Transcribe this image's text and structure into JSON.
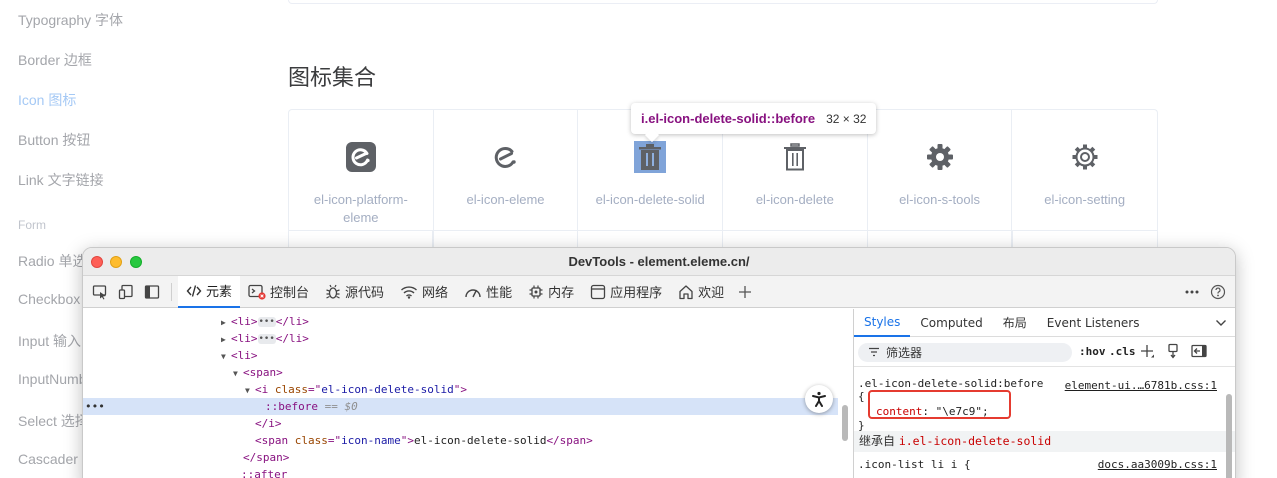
{
  "sidebar": {
    "items": [
      {
        "label": "Typography 字体",
        "active": false
      },
      {
        "label": "Border 边框",
        "active": false
      },
      {
        "label": "Icon 图标",
        "active": true
      },
      {
        "label": "Button 按钮",
        "active": false
      },
      {
        "label": "Link 文字链接",
        "active": false
      }
    ],
    "group_label": "Form",
    "form_items": [
      {
        "label": "Radio 单选"
      },
      {
        "label": "Checkbox"
      },
      {
        "label": "Input 输入"
      },
      {
        "label": "InputNumb"
      },
      {
        "label": "Select 选择"
      },
      {
        "label": "Cascader"
      }
    ]
  },
  "main": {
    "section_title": "图标集合",
    "icons": [
      {
        "name": "el-icon-platform-eleme",
        "icon": "platform-eleme-icon"
      },
      {
        "name": "el-icon-eleme",
        "icon": "eleme-icon"
      },
      {
        "name": "el-icon-delete-solid",
        "icon": "delete-solid-icon",
        "highlighted": true
      },
      {
        "name": "el-icon-delete",
        "icon": "delete-icon"
      },
      {
        "name": "el-icon-s-tools",
        "icon": "s-tools-icon"
      },
      {
        "name": "el-icon-setting",
        "icon": "setting-icon"
      }
    ]
  },
  "inspect_tooltip": {
    "selector": "i.el-icon-delete-solid::before",
    "size": "32 × 32"
  },
  "devtools": {
    "window_title": "DevTools - element.eleme.cn/",
    "tabs": [
      {
        "label": "元素",
        "icon": "code-icon",
        "active": true
      },
      {
        "label": "控制台",
        "icon": "console-icon"
      },
      {
        "label": "源代码",
        "icon": "bug-icon"
      },
      {
        "label": "网络",
        "icon": "wifi-icon"
      },
      {
        "label": "性能",
        "icon": "performance-icon"
      },
      {
        "label": "内存",
        "icon": "memory-icon"
      },
      {
        "label": "应用程序",
        "icon": "application-icon"
      },
      {
        "label": "欢迎",
        "icon": "home-icon"
      }
    ],
    "elements_lines": {
      "l1_open": "<li>",
      "l1_close": "</li>",
      "l2_open": "<li>",
      "l2_close": "</li>",
      "l3": "<li>",
      "l4": "<span>",
      "l5_tag_open": "<i ",
      "l5_attr": "class",
      "l5_eq": "=\"",
      "l5_val": "el-icon-delete-solid",
      "l5_end": "\">",
      "l6_pseudo": "::before",
      "l6_dim": "== $0",
      "l7": "</i>",
      "l8_tag_open": "<span ",
      "l8_attr": "class",
      "l8_eq": "=\"",
      "l8_val": "icon-name",
      "l8_gt": "\">",
      "l8_text": "el-icon-delete-solid",
      "l8_close": "</span>",
      "l9": "</span>",
      "l10": "::after",
      "gutter": "•••",
      "dots": "•••"
    },
    "styles": {
      "tabs": [
        "Styles",
        "Computed",
        "布局",
        "Event Listeners"
      ],
      "filter_placeholder": "筛选器",
      "hov": ":hov",
      "cls": ".cls",
      "rule1_selector": ".el-icon-delete-solid:before",
      "rule1_source": "element-ui.…6781b.css:1",
      "rule1_open": "{",
      "rule1_prop": "content",
      "rule1_value": ": \"\\e7c9\";",
      "rule1_close": "}",
      "inherited_prefix": "继承自 ",
      "inherited_selector": "i.el-icon-delete-solid",
      "rule2_selector": ".icon-list li i {",
      "rule2_source": "docs.aa3009b.css:1"
    }
  }
}
